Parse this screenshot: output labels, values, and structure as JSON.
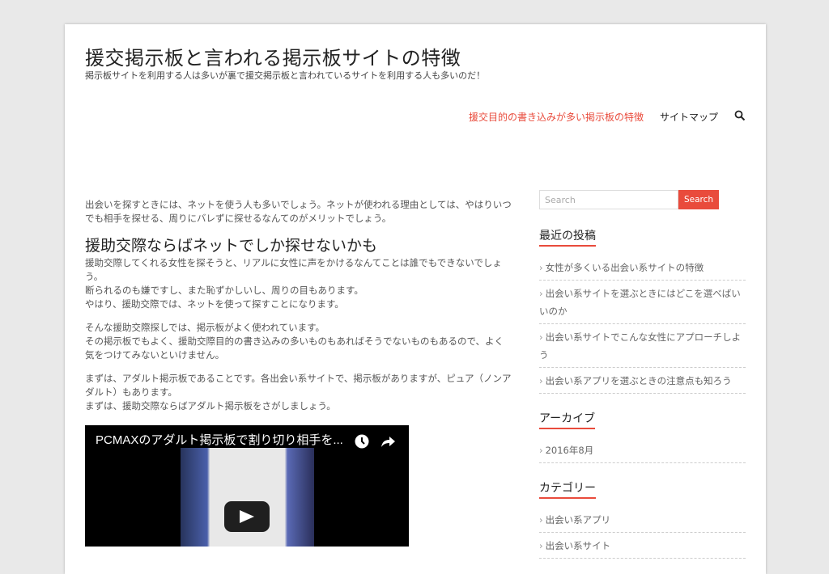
{
  "header": {
    "title": "援交掲示板と言われる掲示板サイトの特徴",
    "description": "掲示板サイトを利用する人は多いが裏で援交掲示板と言われているサイトを利用する人も多いのだ！"
  },
  "nav": {
    "items": [
      {
        "label": "援交目的の書き込みが多い掲示板の特徴"
      },
      {
        "label": "サイトマップ"
      }
    ]
  },
  "content": {
    "intro": "出会いを探すときには、ネットを使う人も多いでしょう。ネットが使われる理由としては、やはりいつでも相手を探せる、周りにバレずに探せるなんてのがメリットでしょう。",
    "heading": "援助交際ならばネットでしか探せないかも",
    "p1_l1": "援助交際してくれる女性を探そうと、リアルに女性に声をかけるなんてことは誰でもできないでしょう。",
    "p1_l2": "断られるのも嫌ですし、また恥ずかしいし、周りの目もあります。",
    "p1_l3": "やはり、援助交際では、ネットを使って探すことになります。",
    "p2_l1": "そんな援助交際探しでは、掲示板がよく使われています。",
    "p2_l2": "その掲示板でもよく、援助交際目的の書き込みの多いものもあればそうでないものもあるので、よく気をつけてみないといけません。",
    "p3_l1": "まずは、アダルト掲示板であることです。各出会い系サイトで、掲示板がありますが、ピュア（ノンアダルト）もあります。",
    "p3_l2": "まずは、援助交際ならばアダルト掲示板をさがしましょう。",
    "video_title": "PCMAXのアダルト掲示板で割り切り相手を..."
  },
  "sidebar": {
    "search_placeholder": "Search",
    "search_button": "Search",
    "recent": {
      "title": "最近の投稿",
      "items": [
        "女性が多くいる出会い系サイトの特徴",
        "出会い系サイトを選ぶときにはどこを選べばいいのか",
        "出会い系サイトでこんな女性にアプローチしよう",
        "出会い系アプリを選ぶときの注意点も知ろう"
      ]
    },
    "archive": {
      "title": "アーカイブ",
      "items": [
        "2016年8月"
      ]
    },
    "categories": {
      "title": "カテゴリー",
      "items": [
        "出会い系アプリ",
        "出会い系サイト"
      ]
    }
  },
  "colors": {
    "accent": "#e94b3c",
    "background": "#e9e9e9"
  },
  "icons": {
    "nav_search": "search-icon",
    "video_clock": "watch-later-icon",
    "video_share": "share-icon",
    "video_play": "play-icon"
  }
}
